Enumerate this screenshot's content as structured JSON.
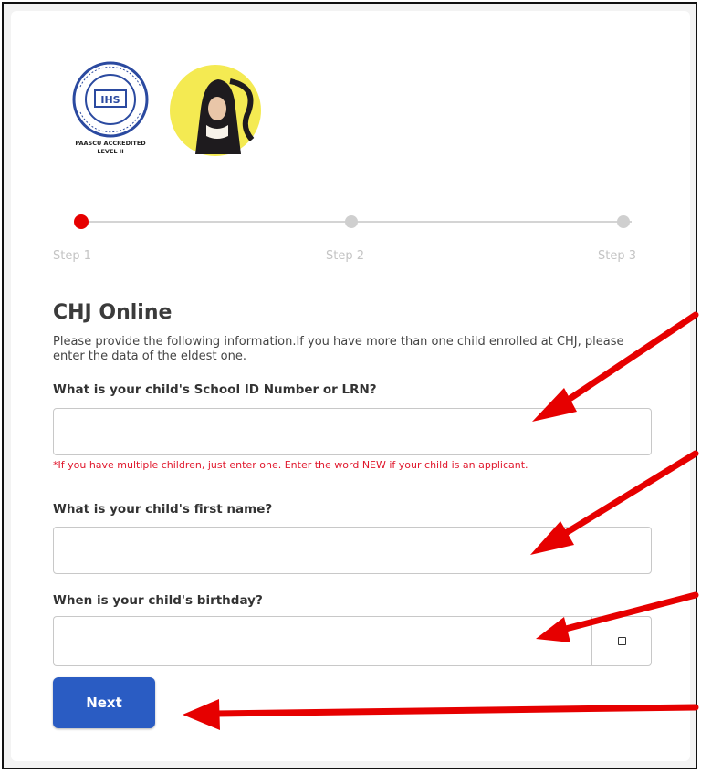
{
  "logos": {
    "seal_lines": [
      "PAASCU ACCREDITED",
      "LEVEL II"
    ],
    "seal_center_text": "IHS",
    "portrait_icon": "nun-portrait-icon"
  },
  "stepper": {
    "steps": [
      {
        "label": "Step 1",
        "active": true
      },
      {
        "label": "Step 2",
        "active": false
      },
      {
        "label": "Step 3",
        "active": false
      }
    ],
    "active_color": "#e60000",
    "inactive_color": "#cfcfcf"
  },
  "form": {
    "title": "CHJ Online",
    "intro": "Please provide the following information.If you have more than one child enrolled at CHJ, please enter the data of the eldest one.",
    "q1_label": "What is your child's School ID Number or LRN?",
    "q1_value": "",
    "q1_note": "*If you have multiple children, just enter one. Enter the word NEW if your child is an applicant.",
    "q2_label": "What is your child's first name?",
    "q2_value": "",
    "q3_label": "When is your child's birthday?",
    "q3_value": "",
    "calendar_icon": "calendar-icon",
    "next_label": "Next"
  },
  "colors": {
    "primary_button": "#2a5cc3",
    "note_red": "#e0182d",
    "annotation_arrow": "#e60000"
  }
}
